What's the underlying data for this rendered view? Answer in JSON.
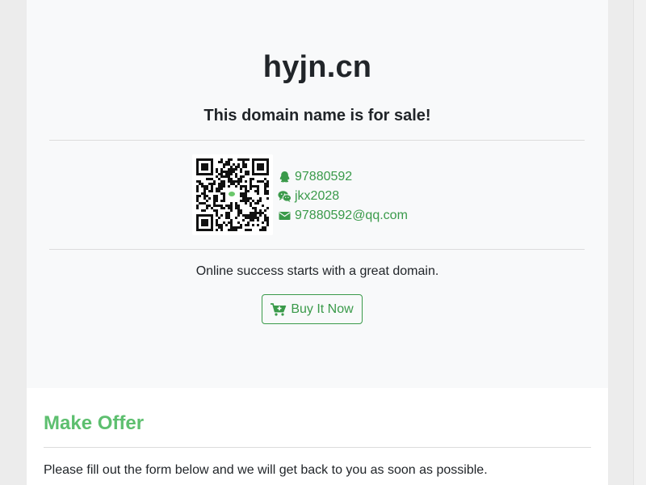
{
  "hero": {
    "domain": "hyjn.cn",
    "subtitle": "This domain name is for sale!",
    "tagline": "Online success starts with a great domain.",
    "buy_label": "Buy It Now"
  },
  "contact": {
    "qq": "97880592",
    "wechat": "jkx2028",
    "email": "97880592@qq.com",
    "qq_icon": "qq-icon",
    "wechat_icon": "wechat-icon",
    "email_icon": "envelope-icon"
  },
  "offer": {
    "title": "Make Offer",
    "description": "Please fill out the form below and we will get back to you as soon as possible."
  },
  "colors": {
    "accent": "#3a9a4a",
    "offer_title": "#5dbf6f",
    "hero_bg": "#f8f9fa",
    "page_bg": "#ececec"
  }
}
